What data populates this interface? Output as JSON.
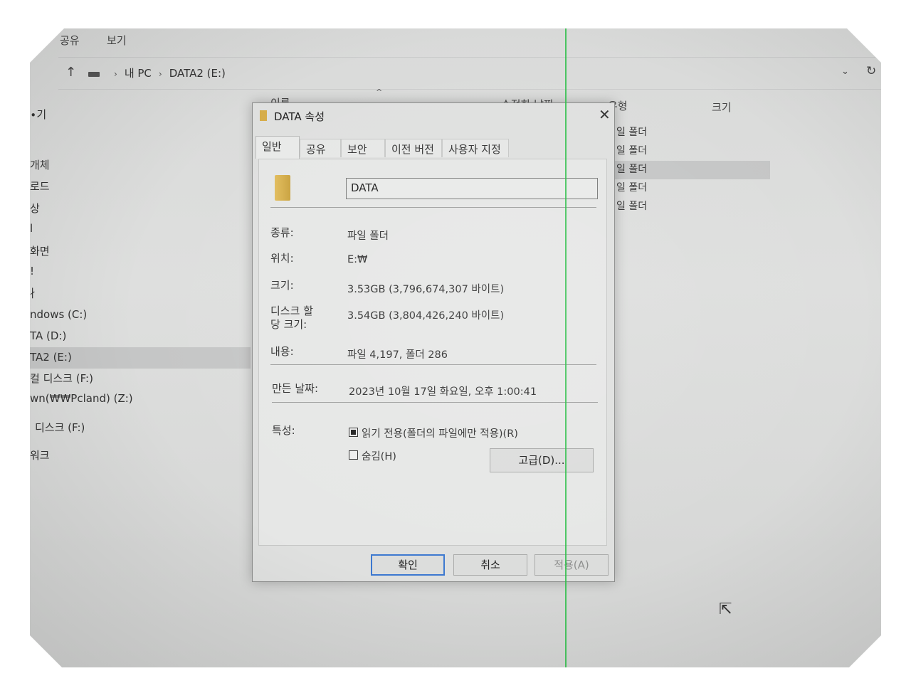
{
  "ribbon": {
    "share": "공유",
    "view": "보기"
  },
  "address": {
    "crumbs": [
      "내 PC",
      "DATA2 (E:)"
    ]
  },
  "nav": [
    "∙기",
    "개체",
    "로드",
    "상",
    "l",
    "화면",
    "!",
    "∤",
    "ndows (C:)",
    "TA (D:)",
    "TA2 (E:)",
    "컬 디스크 (F:)",
    "wn(₩₩Pcland) (Z:)",
    "디스크 (F:)",
    "워크"
  ],
  "columns": {
    "name": "이름",
    "modified": "수정한 날짜",
    "type": "유형",
    "size": "크기"
  },
  "rows": [
    {
      "type": "일 폴더"
    },
    {
      "type": "일 폴더"
    },
    {
      "type": "일 폴더"
    },
    {
      "type": "일 폴더"
    },
    {
      "type": "일 폴더"
    }
  ],
  "dialog": {
    "title": "DATA 속성",
    "tabs": [
      "일반",
      "공유",
      "보안",
      "이전 버전",
      "사용자 지정"
    ],
    "name_value": "DATA",
    "props": {
      "type_label": "종류:",
      "type_value": "파일 폴더",
      "location_label": "위치:",
      "location_value": "E:₩",
      "size_label": "크기:",
      "size_value": "3.53GB (3,796,674,307 바이트)",
      "disk_label_1": "디스크 할",
      "disk_label_2": "당 크기:",
      "disk_value": "3.54GB (3,804,426,240 바이트)",
      "contents_label": "내용:",
      "contents_value": "파일 4,197, 폴더 286",
      "created_label": "만든 날짜:",
      "created_value": "2023년 10월 17일 화요일, 오후 1:00:41",
      "attr_label": "특성:"
    },
    "readonly_label": "읽기 전용(폴더의 파일에만 적용)(R)",
    "hidden_label": "숨김(H)",
    "advanced_label": "고급(D)...",
    "ok_label": "확인",
    "cancel_label": "취소",
    "apply_label": "적용(A)"
  }
}
